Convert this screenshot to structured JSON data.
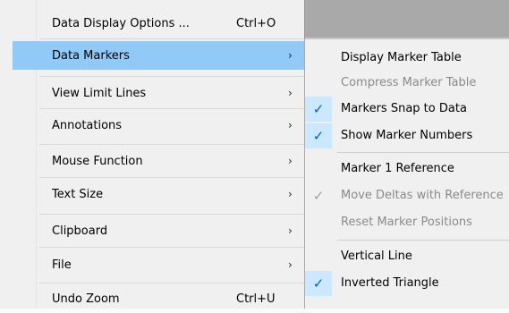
{
  "main_menu": {
    "items": [
      {
        "label": "Data Display Options ...",
        "shortcut": "Ctrl+O",
        "submenu": false,
        "highlighted": false
      },
      {
        "label": "Data Markers",
        "shortcut": "",
        "submenu": true,
        "highlighted": true
      },
      {
        "label": "View Limit Lines",
        "shortcut": "",
        "submenu": true,
        "highlighted": false
      },
      {
        "label": "Annotations",
        "shortcut": "",
        "submenu": true,
        "highlighted": false
      },
      {
        "label": "Mouse Function",
        "shortcut": "",
        "submenu": true,
        "highlighted": false
      },
      {
        "label": "Text Size",
        "shortcut": "",
        "submenu": true,
        "highlighted": false
      },
      {
        "label": "Clipboard",
        "shortcut": "",
        "submenu": true,
        "highlighted": false
      },
      {
        "label": "File",
        "shortcut": "",
        "submenu": true,
        "highlighted": false
      },
      {
        "label": "Undo Zoom",
        "shortcut": "Ctrl+U",
        "submenu": false,
        "highlighted": false
      }
    ],
    "submenu_arrow": "›"
  },
  "data_markers_submenu": {
    "items": [
      {
        "label": "Display Marker Table",
        "checked": false,
        "enabled": true
      },
      {
        "label": "Compress Marker Table",
        "checked": false,
        "enabled": false
      },
      {
        "label": "Markers Snap to Data",
        "checked": true,
        "enabled": true
      },
      {
        "label": "Show Marker Numbers",
        "checked": true,
        "enabled": true
      },
      {
        "label": "Marker 1 Reference",
        "checked": false,
        "enabled": true
      },
      {
        "label": "Move Deltas with Reference",
        "checked": true,
        "enabled": false
      },
      {
        "label": "Reset Marker Positions",
        "checked": false,
        "enabled": false
      },
      {
        "label": "Vertical Line",
        "checked": false,
        "enabled": true
      },
      {
        "label": "Inverted Triangle",
        "checked": true,
        "enabled": true
      }
    ],
    "check_glyph": "✓"
  },
  "colors": {
    "menu_bg": "#f0f0f0",
    "highlight": "#91c9f7",
    "check_bg": "#cce8ff",
    "check_color": "#0060c0",
    "disabled_text": "#8a8a8a"
  }
}
